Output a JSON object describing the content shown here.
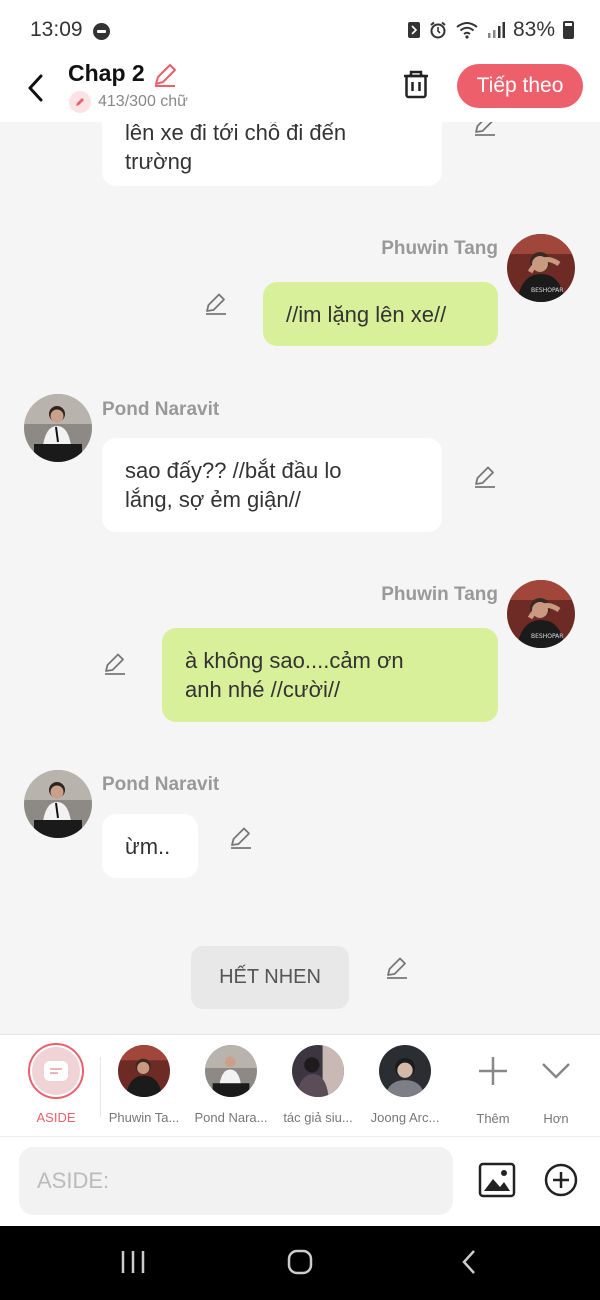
{
  "status_bar": {
    "time": "13:09",
    "battery": "83%"
  },
  "header": {
    "title": "Chap 2",
    "word_count": "413/300 chữ",
    "next_label": "Tiếp theo"
  },
  "messages": [
    {
      "type": "left",
      "lines": [
        "lên xe đi tới chỗ đi đến",
        "trường"
      ]
    },
    {
      "type": "right",
      "name": "Phuwin Tang",
      "lines": [
        "//im lặng lên xe//"
      ]
    },
    {
      "type": "left",
      "name": "Pond Naravit",
      "lines": [
        "sao đấy?? //bắt đầu lo",
        "lắng, sợ ẻm giận//"
      ]
    },
    {
      "type": "right",
      "name": "Phuwin Tang",
      "lines": [
        "à không sao....cảm ơn",
        "anh nhé //cười//"
      ]
    },
    {
      "type": "left",
      "name": "Pond Naravit",
      "lines": [
        "ừm.."
      ]
    },
    {
      "type": "aside",
      "lines": [
        "HẾT NHEN"
      ]
    }
  ],
  "characters": [
    {
      "label": "ASIDE",
      "selected": true
    },
    {
      "label": "Phuwin Ta..."
    },
    {
      "label": "Pond Nara..."
    },
    {
      "label": "tác giả siu..."
    },
    {
      "label": "Joong Arc..."
    }
  ],
  "char_actions": {
    "add_label": "Thêm",
    "more_label": "Hơn"
  },
  "input": {
    "placeholder": "ASIDE:"
  },
  "colors": {
    "accent": "#ec5f6b",
    "self_bubble": "#d9f09a",
    "other_bubble": "#ffffff"
  },
  "icons": [
    "back-arrow-icon",
    "pencil-icon",
    "trash-icon",
    "image-icon",
    "add-circle-icon",
    "recents-icon",
    "home-icon",
    "nav-back-icon"
  ]
}
